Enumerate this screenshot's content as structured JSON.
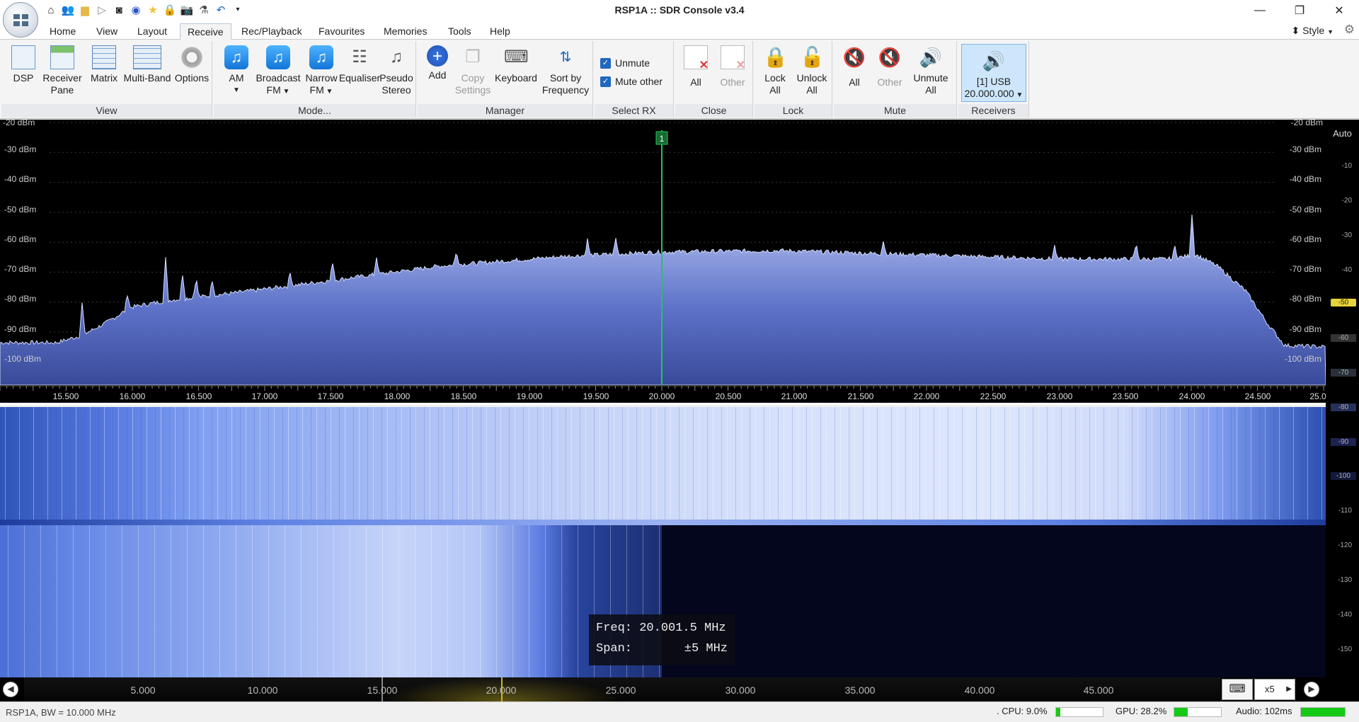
{
  "window": {
    "title": "RSP1A :: SDR Console v3.4"
  },
  "quick_access": {
    "icons": [
      "home-icon",
      "users-icon",
      "folder-icon",
      "play-icon",
      "stop-icon",
      "record-icon",
      "star-icon",
      "lock-icon",
      "camera-icon",
      "flask-icon",
      "undo-icon",
      "dropdown-icon"
    ]
  },
  "tabs": [
    "Home",
    "View",
    "Layout",
    "Receive",
    "Rec/Playback",
    "Favourites",
    "Memories",
    "Tools",
    "Help"
  ],
  "active_tab": "Receive",
  "style_label": "Style",
  "ribbon": {
    "view": {
      "label": "View",
      "dsp": "DSP",
      "receiver_pane_1": "Receiver",
      "receiver_pane_2": "Pane",
      "matrix": "Matrix",
      "multiband": "Multi-Band",
      "options": "Options"
    },
    "mode": {
      "label": "Mode...",
      "am": "AM",
      "bfm_1": "Broadcast",
      "bfm_2": "FM",
      "nfm_1": "Narrow",
      "nfm_2": "FM",
      "equaliser": "Equaliser",
      "pseudo_1": "Pseudo",
      "pseudo_2": "Stereo"
    },
    "manager": {
      "label": "Manager",
      "add": "Add",
      "copy_1": "Copy",
      "copy_2": "Settings",
      "keyboard": "Keyboard",
      "sort_1": "Sort by",
      "sort_2": "Frequency"
    },
    "select_rx": {
      "label": "Select RX",
      "unmute": "Unmute",
      "mute_other": "Mute other",
      "unmute_checked": true,
      "mute_other_checked": true
    },
    "close": {
      "label": "Close",
      "all": "All",
      "other": "Other"
    },
    "lock": {
      "label": "Lock",
      "lock_1": "Lock",
      "lock_2": "All",
      "unlock_1": "Unlock",
      "unlock_2": "All"
    },
    "mute": {
      "label": "Mute",
      "all": "All",
      "other": "Other",
      "unmute_1": "Unmute",
      "unmute_2": "All"
    },
    "receivers": {
      "label": "Receivers",
      "line1": "[1]  USB",
      "line2": "20.000.000"
    }
  },
  "spectrum": {
    "dbm_labels": [
      "-20 dBm",
      "-30 dBm",
      "-40 dBm",
      "-50 dBm",
      "-60 dBm",
      "-70 dBm",
      "-80 dBm",
      "-90 dBm",
      "-100 dBm"
    ],
    "marker_label": "1",
    "freq_ticks": [
      "15.500",
      "16.000",
      "16.500",
      "17.000",
      "17.500",
      "18.000",
      "18.500",
      "19.000",
      "19.500",
      "20.000",
      "20.500",
      "21.000",
      "21.500",
      "22.000",
      "22.500",
      "23.000",
      "23.500",
      "24.000",
      "24.500",
      "25.0"
    ]
  },
  "sidebar": {
    "auto": "Auto",
    "scale": [
      "-10",
      "-20",
      "-30",
      "-40",
      "-50",
      "-60",
      "-70",
      "-80",
      "-90",
      "-100",
      "-110",
      "-120",
      "-130",
      "-140",
      "-150"
    ],
    "highlight": "-50"
  },
  "tooltip": {
    "freq_label": "Freq:",
    "freq_value": "20.001.5 MHz",
    "span_label": "Span:",
    "span_value": "±5 MHz"
  },
  "overview": {
    "ticks": [
      "5.000",
      "10.000",
      "15.000",
      "20.000",
      "25.000",
      "30.000",
      "35.000",
      "40.000",
      "45.000"
    ],
    "zoom": "x5"
  },
  "status": {
    "left": "RSP1A, BW = 10.000 MHz",
    "cpu": ". CPU: 9.0%",
    "gpu": "GPU: 28.2%",
    "audio": "Audio: 102ms",
    "cpu_level": 0.09,
    "gpu_level": 0.282,
    "audio_level": 1.0
  },
  "colors": {
    "accent": "#1f67c1",
    "marker": "#22c55e",
    "trace": "#cbd6f5",
    "waterfall": "#6f8ff0"
  }
}
